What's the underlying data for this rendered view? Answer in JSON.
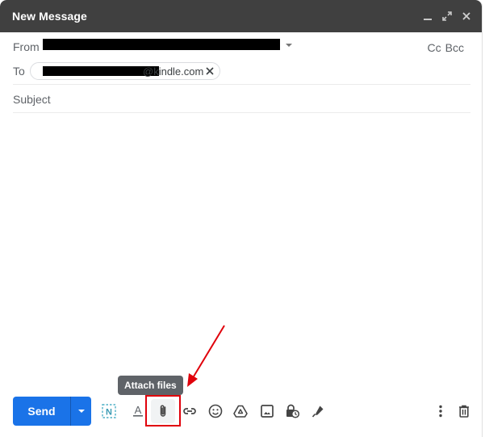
{
  "window": {
    "title": "New Message",
    "controls": [
      {
        "name": "minimize-icon",
        "label": "Minimize"
      },
      {
        "name": "fullscreen-icon",
        "label": "Full screen"
      },
      {
        "name": "close-icon",
        "label": "Close"
      }
    ]
  },
  "from": {
    "label": "From",
    "value_redacted": true
  },
  "cc_label": "Cc",
  "bcc_label": "Bcc",
  "to": {
    "label": "To",
    "recipients": [
      {
        "visible_suffix": "@kindle.com",
        "redacted_prefix": true
      }
    ]
  },
  "subject": {
    "placeholder": "Subject",
    "value": ""
  },
  "body": {
    "value": ""
  },
  "toolbar": {
    "send_label": "Send",
    "send_options_icon": "dropdown-caret",
    "tools": [
      {
        "name": "notion-extension-icon",
        "label": "Extension"
      },
      {
        "name": "formatting-options-icon",
        "label": "Formatting options"
      },
      {
        "name": "attach-files-icon",
        "label": "Attach files",
        "active": true
      },
      {
        "name": "insert-link-icon",
        "label": "Insert link"
      },
      {
        "name": "insert-emoji-icon",
        "label": "Insert emoji"
      },
      {
        "name": "google-drive-icon",
        "label": "Insert files using Drive"
      },
      {
        "name": "insert-photo-icon",
        "label": "Insert photo"
      },
      {
        "name": "confidential-mode-icon",
        "label": "Toggle confidential mode"
      },
      {
        "name": "insert-signature-icon",
        "label": "Insert signature"
      },
      {
        "name": "more-options-icon",
        "label": "More options"
      },
      {
        "name": "discard-draft-icon",
        "label": "Discard draft"
      }
    ]
  },
  "tooltip": {
    "text": "Attach files"
  },
  "annotation": {
    "highlight_color": "#e0000b",
    "arrow_color": "#e0000b"
  },
  "colors": {
    "titlebar": "#404040",
    "send_button": "#1a73e8"
  }
}
